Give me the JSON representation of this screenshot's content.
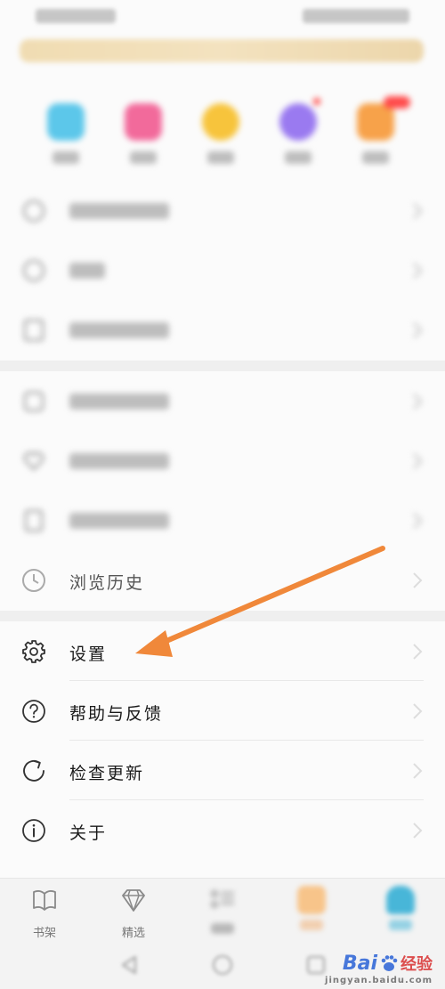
{
  "menu": {
    "items": [
      {
        "name": "browsing-history",
        "label": "浏览历史",
        "icon": "clock-icon"
      },
      {
        "name": "settings",
        "label": "设置",
        "icon": "gear-icon"
      },
      {
        "name": "help-feedback",
        "label": "帮助与反馈",
        "icon": "question-circle-icon"
      },
      {
        "name": "check-update",
        "label": "检查更新",
        "icon": "refresh-icon"
      },
      {
        "name": "about",
        "label": "关于",
        "icon": "info-circle-icon"
      }
    ]
  },
  "tabbar": {
    "tabs": [
      {
        "label": "书架",
        "icon": "book-icon"
      },
      {
        "label": "精选",
        "icon": "diamond-icon"
      }
    ]
  },
  "watermark": {
    "brand": "Bai",
    "brand_tail": "经验",
    "sub": "jingyan.baidu.com"
  },
  "colors": {
    "arrow": "#f0883a",
    "quick_icons": [
      "#5cc7ea",
      "#f26a9b",
      "#f7c43c",
      "#9a7af0",
      "#f7a24a"
    ],
    "active_tab": "#48b6d8"
  }
}
